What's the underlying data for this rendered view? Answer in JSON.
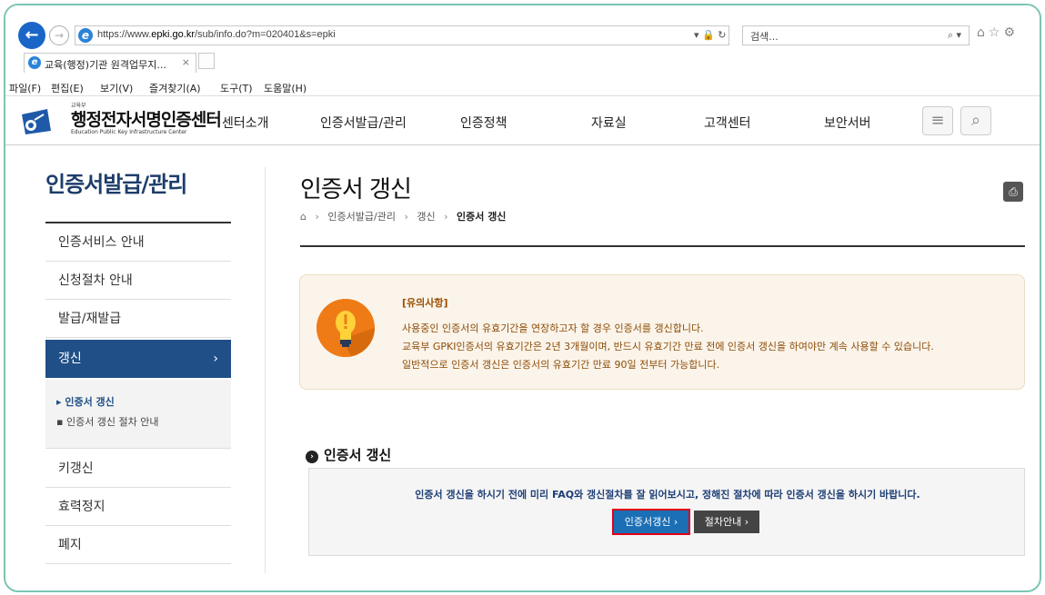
{
  "browser": {
    "url_prefix": "https://www.",
    "url_domain": "epki.go.kr",
    "url_path": "/sub/info.do?m=020401&s=epki",
    "url_tools": "▾ 🔒 ↻",
    "search_placeholder": "검색...",
    "search_icon": "⌕ ▾",
    "icons": "⌂☆⚙",
    "tab_title": "교육(행정)기관 원격업무지...",
    "tab_close": "×",
    "menu": [
      "파일(F)",
      "편집(E)",
      "보기(V)",
      "즐겨찾기(A)",
      "도구(T)",
      "도움말(H)"
    ]
  },
  "header": {
    "logo_small": "교육부",
    "logo_main": "행정전자서명인증센터",
    "logo_sub": "Education Public Key Infrastructure Center",
    "gnb": [
      "센터소개",
      "인증서발급/관리",
      "인증정책",
      "자료실",
      "고객센터",
      "보안서버"
    ],
    "menu_icon": "≡",
    "search_icon": "⌕"
  },
  "sidebar": {
    "title": "인증서발급/관리",
    "items": [
      "인증서비스 안내",
      "신청절차 안내",
      "발급/재발급",
      "갱신",
      "키갱신",
      "효력정지",
      "폐지"
    ],
    "active_arrow": "›",
    "sub_items": [
      "▸ 인증서 갱신",
      "▪ 인증서 갱신 절차 안내"
    ]
  },
  "main": {
    "title": "인증서 갱신",
    "print_icon": "⎙",
    "breadcrumb": [
      "인증서발급/관리",
      "갱신",
      "인증서 갱신"
    ],
    "breadcrumb_sep": "›",
    "breadcrumb_home": "⌂",
    "notice": {
      "title": "[유의사항]",
      "lines": [
        "사용중인 인증서의 유효기간을 연장하고자 할 경우 인증서를 갱신합니다.",
        "교육부 GPKI인증서의 유효기간은 2년 3개월이며, 반드시 유효기간 만료 전에 인증서 갱신을 하여야만 계속 사용할 수 있습니다.",
        "일반적으로 인증서 갱신은 인증서의 유효기간 만료 90일 전부터 가능합니다."
      ]
    },
    "section_title": "인증서 갱신",
    "section_icon": "›",
    "action_message": "인증서 갱신을 하시기 전에 미리 FAQ와 갱신절차를 잘 읽어보시고, 정해진 절차에 따라 인증서 갱신을 하시기 바랍니다.",
    "btn_renew": "인증서갱신 ›",
    "btn_guide": "절차안내 ›"
  },
  "colors": {
    "brand_navy": "#1f4f86",
    "highlight_red": "#e2001a",
    "notice_text": "#8c4c08",
    "notice_icon": "#ef7b17",
    "frame_teal": "#7cc5b4"
  }
}
